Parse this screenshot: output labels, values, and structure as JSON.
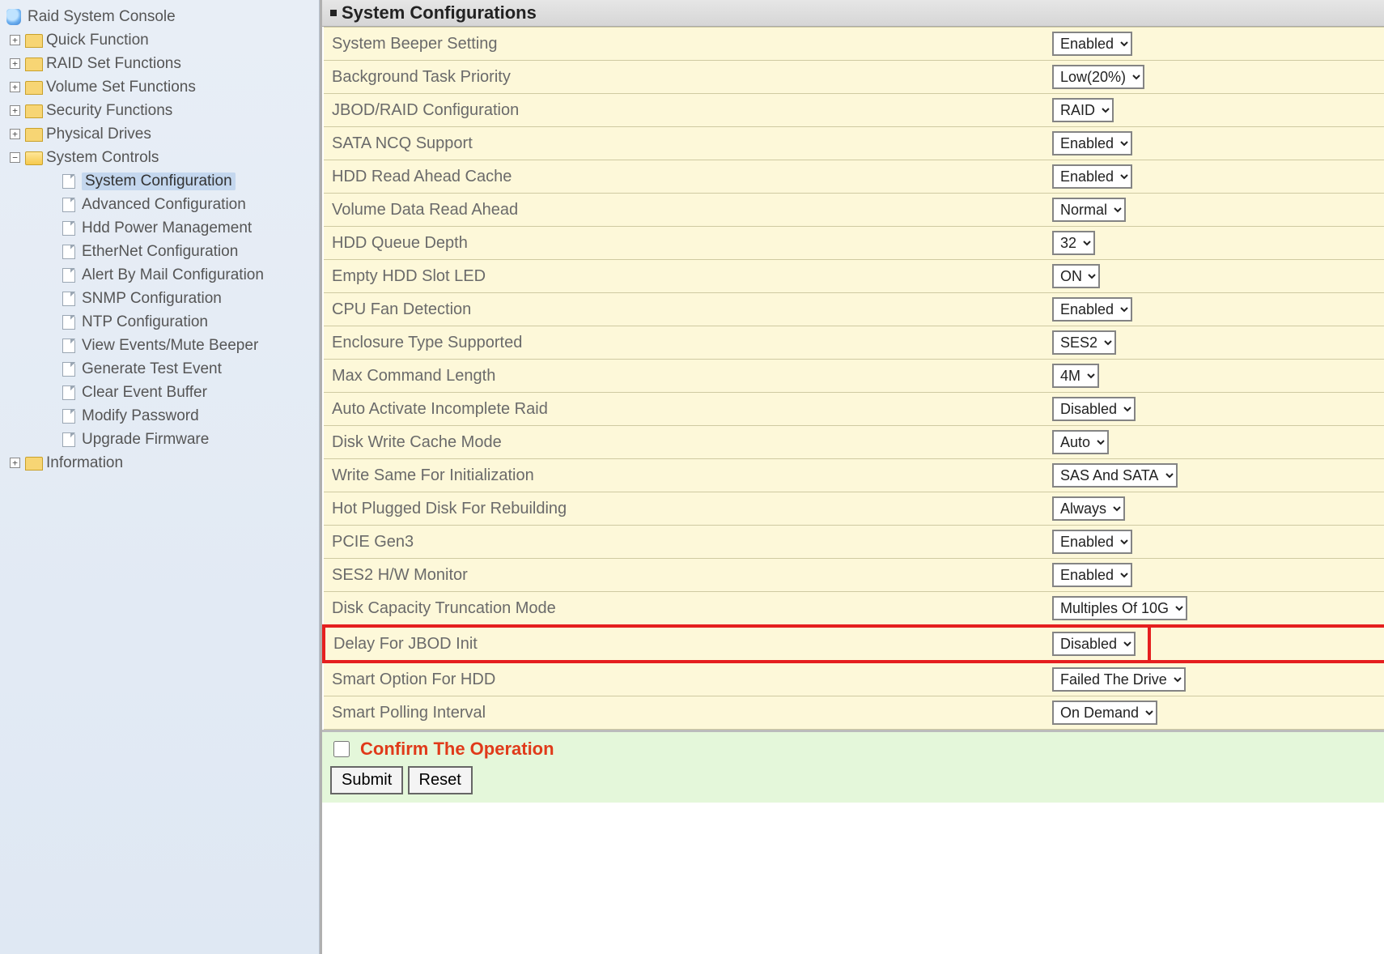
{
  "sidebar": {
    "root": "Raid System Console",
    "nodes": [
      {
        "label": "Quick Function",
        "exp": "+"
      },
      {
        "label": "RAID Set Functions",
        "exp": "+"
      },
      {
        "label": "Volume Set Functions",
        "exp": "+"
      },
      {
        "label": "Security Functions",
        "exp": "+"
      },
      {
        "label": "Physical Drives",
        "exp": "+"
      },
      {
        "label": "System Controls",
        "exp": "−",
        "children": [
          "System Configuration",
          "Advanced Configuration",
          "Hdd Power Management",
          "EtherNet Configuration",
          "Alert By Mail Configuration",
          "SNMP Configuration",
          "NTP Configuration",
          "View Events/Mute Beeper",
          "Generate Test Event",
          "Clear Event Buffer",
          "Modify Password",
          "Upgrade Firmware"
        ]
      },
      {
        "label": "Information",
        "exp": "+"
      }
    ],
    "selected": "System Configuration"
  },
  "panel": {
    "title": "System Configurations",
    "rows": [
      {
        "label": "System Beeper Setting",
        "value": "Enabled"
      },
      {
        "label": "Background Task Priority",
        "value": "Low(20%)"
      },
      {
        "label": "JBOD/RAID Configuration",
        "value": "RAID"
      },
      {
        "label": "SATA NCQ Support",
        "value": "Enabled"
      },
      {
        "label": "HDD Read Ahead Cache",
        "value": "Enabled"
      },
      {
        "label": "Volume Data Read Ahead",
        "value": "Normal"
      },
      {
        "label": "HDD Queue Depth",
        "value": "32"
      },
      {
        "label": "Empty HDD Slot LED",
        "value": "ON"
      },
      {
        "label": "CPU Fan Detection",
        "value": "Enabled"
      },
      {
        "label": "Enclosure Type Supported",
        "value": "SES2"
      },
      {
        "label": "Max Command Length",
        "value": "4M"
      },
      {
        "label": "Auto Activate Incomplete Raid",
        "value": "Disabled"
      },
      {
        "label": "Disk Write Cache Mode",
        "value": "Auto"
      },
      {
        "label": "Write Same For Initialization",
        "value": "SAS And SATA"
      },
      {
        "label": "Hot Plugged Disk For Rebuilding",
        "value": "Always"
      },
      {
        "label": "PCIE Gen3",
        "value": "Enabled"
      },
      {
        "label": "SES2 H/W Monitor",
        "value": "Enabled"
      },
      {
        "label": "Disk Capacity Truncation Mode",
        "value": "Multiples Of 10G"
      },
      {
        "label": "Delay For JBOD Init",
        "value": "Disabled",
        "highlight": true
      },
      {
        "label": "Smart Option For HDD",
        "value": "Failed The Drive"
      },
      {
        "label": "Smart Polling Interval",
        "value": "On Demand"
      }
    ],
    "confirm_label": "Confirm The Operation",
    "submit_label": "Submit",
    "reset_label": "Reset"
  }
}
